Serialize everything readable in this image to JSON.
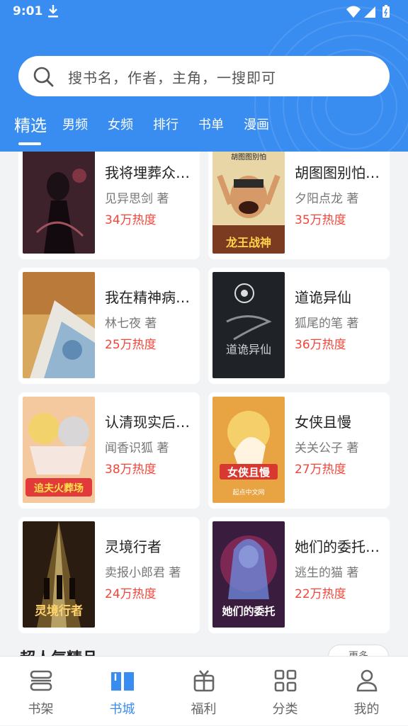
{
  "status_bar": {
    "time": "9:01"
  },
  "search": {
    "placeholder": "搜书名，作者，主角，一搜即可"
  },
  "tabs": [
    {
      "label": "精选",
      "active": true
    },
    {
      "label": "男频"
    },
    {
      "label": "女频"
    },
    {
      "label": "排行"
    },
    {
      "label": "书单"
    },
    {
      "label": "漫画"
    }
  ],
  "books": [
    {
      "title": "我将埋葬众…",
      "author": "见异思剑 著",
      "heat": "34万热度"
    },
    {
      "title": "胡图图别怕…",
      "author": "夕阳点龙 著",
      "heat": "35万热度"
    },
    {
      "title": "我在精神病…",
      "author": "林七夜 著",
      "heat": "25万热度"
    },
    {
      "title": "道诡异仙",
      "author": "狐尾的笔 著",
      "heat": "36万热度"
    },
    {
      "title": "认清现实后…",
      "author": "闻香识狐 著",
      "heat": "38万热度"
    },
    {
      "title": "女侠且慢",
      "author": "关关公子 著",
      "heat": "27万热度"
    },
    {
      "title": "灵境行者",
      "author": "卖报小郎君 著",
      "heat": "24万热度"
    },
    {
      "title": "她们的委托…",
      "author": "逃生的猫 著",
      "heat": "22万热度"
    }
  ],
  "cover_text": {
    "c2_top": "胡图图别怕",
    "c2_bottom": "龙王战神",
    "c4_text": "道诡异仙",
    "c5_banner": "追夫火葬场",
    "c6_text": "女侠且慢",
    "c6_footer": "起点中文网",
    "c7_text": "灵境行者",
    "c8_text": "她们的委托"
  },
  "section": {
    "title": "超人气精品",
    "more": "更多"
  },
  "bottom_nav": [
    {
      "label": "书架",
      "icon": "bookshelf-icon"
    },
    {
      "label": "书城",
      "icon": "book-open-icon",
      "active": true
    },
    {
      "label": "福利",
      "icon": "gift-icon"
    },
    {
      "label": "分类",
      "icon": "grid-icon"
    },
    {
      "label": "我的",
      "icon": "user-icon"
    }
  ],
  "colors": {
    "primary": "#3a8df0",
    "heat": "#f0473a",
    "background": "#f2f3f5"
  }
}
